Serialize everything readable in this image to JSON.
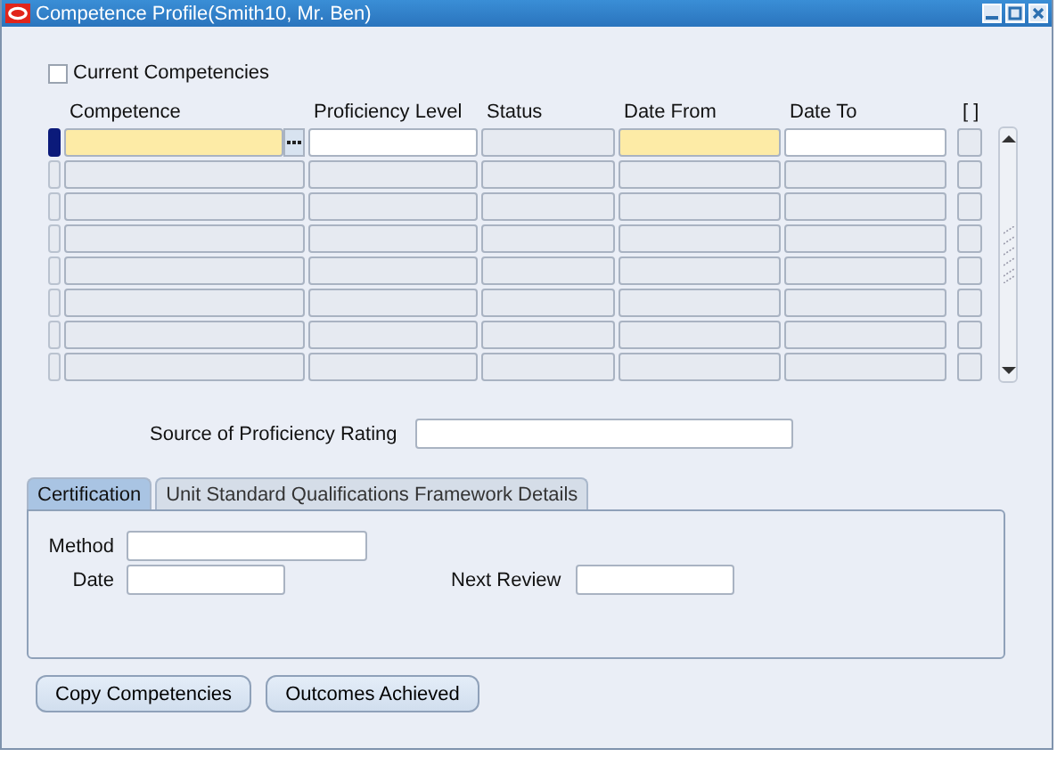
{
  "window": {
    "title": "Competence Profile(Smith10, Mr. Ben)"
  },
  "current_competencies": {
    "label": "Current Competencies",
    "checked": false
  },
  "table": {
    "columns": [
      {
        "label": "Competence",
        "required": true,
        "disabled": false,
        "lov": true
      },
      {
        "label": "Proficiency Level",
        "required": false,
        "disabled": false,
        "lov": false
      },
      {
        "label": "Status",
        "disabled": true,
        "lov": false
      },
      {
        "label": "Date From",
        "required": true,
        "disabled": false,
        "lov": false
      },
      {
        "label": "Date To",
        "required": false,
        "disabled": false,
        "lov": false
      },
      {
        "label": "[ ]",
        "disabled": true,
        "lov": false
      }
    ],
    "rows": [
      {
        "selected": true
      },
      {
        "selected": false
      },
      {
        "selected": false
      },
      {
        "selected": false
      },
      {
        "selected": false
      },
      {
        "selected": false
      },
      {
        "selected": false
      },
      {
        "selected": false
      }
    ]
  },
  "source": {
    "label": "Source of Proficiency Rating"
  },
  "tabs": [
    {
      "label": "Certification",
      "selected": true
    },
    {
      "label": "Unit Standard Qualifications Framework Details",
      "selected": false
    }
  ],
  "certification": {
    "method_label": "Method",
    "date_label": "Date",
    "next_review_label": "Next Review"
  },
  "buttons": [
    "Copy Competencies",
    "Outcomes Achieved"
  ]
}
